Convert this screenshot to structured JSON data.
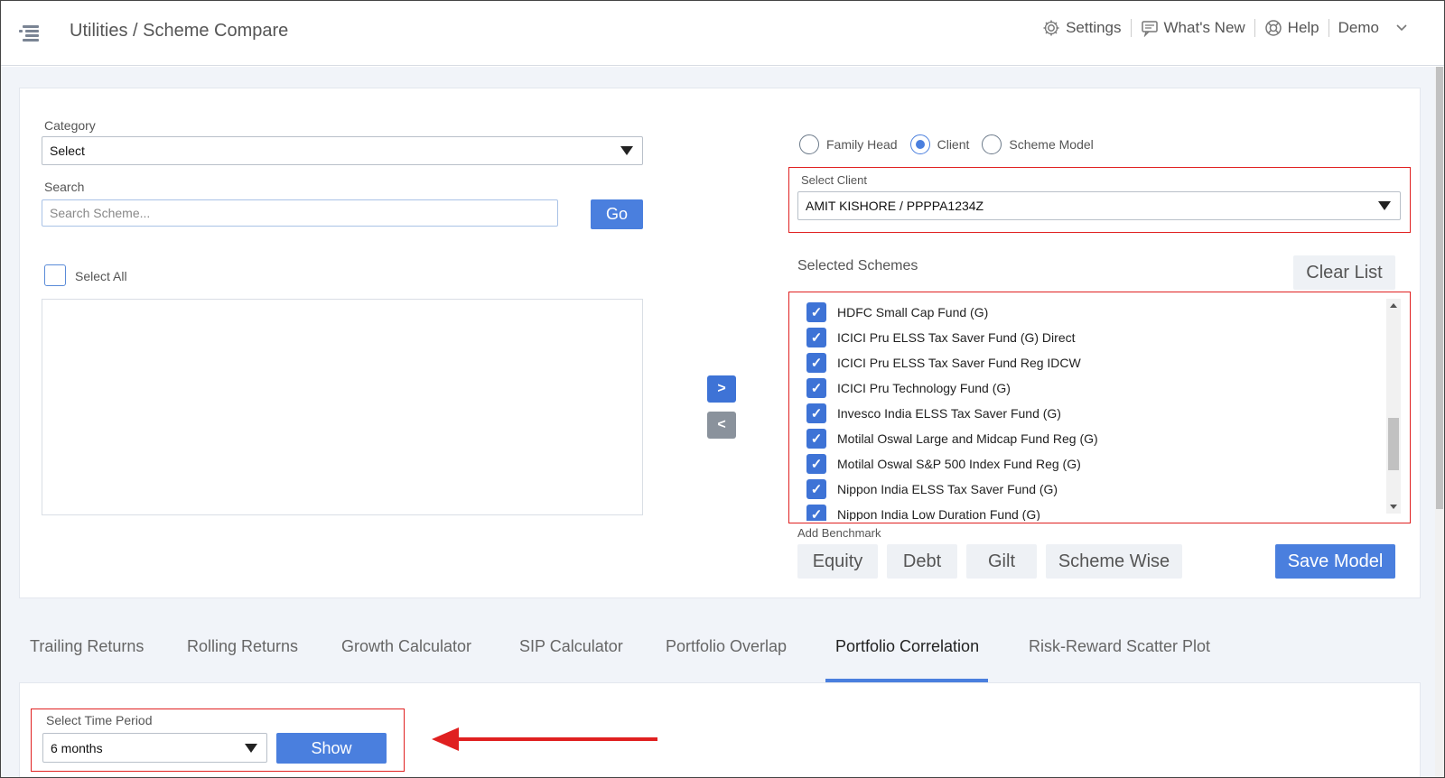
{
  "header": {
    "breadcrumb": "Utilities / Scheme Compare",
    "settings_label": "Settings",
    "whats_new_label": "What's New",
    "help_label": "Help",
    "user_label": "Demo"
  },
  "left_panel": {
    "category_label": "Category",
    "category_value": "Select",
    "search_label": "Search",
    "search_placeholder": "Search Scheme...",
    "go_label": "Go",
    "select_all_label": "Select All"
  },
  "transfer": {
    "add_label": ">",
    "remove_label": "<"
  },
  "right_panel": {
    "radio_options": [
      {
        "label": "Family Head",
        "selected": false
      },
      {
        "label": "Client",
        "selected": true
      },
      {
        "label": "Scheme Model",
        "selected": false
      }
    ],
    "select_client_label": "Select Client",
    "select_client_value": "AMIT KISHORE / PPPPA1234Z",
    "selected_schemes_label": "Selected Schemes",
    "clear_list_label": "Clear List",
    "schemes": [
      "HDFC Small Cap Fund (G)",
      "ICICI Pru ELSS Tax Saver Fund (G) Direct",
      "ICICI Pru ELSS Tax Saver Fund Reg IDCW",
      "ICICI Pru Technology Fund (G)",
      "Invesco India ELSS Tax Saver Fund (G)",
      "Motilal Oswal Large and Midcap Fund Reg (G)",
      "Motilal Oswal S&P 500 Index Fund Reg (G)",
      "Nippon India ELSS Tax Saver Fund (G)",
      "Nippon India Low Duration Fund (G)"
    ],
    "add_benchmark_label": "Add Benchmark",
    "benchmark_buttons": [
      "Equity",
      "Debt",
      "Gilt",
      "Scheme Wise"
    ],
    "save_model_label": "Save Model"
  },
  "tabs": [
    {
      "label": "Trailing Returns",
      "active": false
    },
    {
      "label": "Rolling Returns",
      "active": false
    },
    {
      "label": "Growth Calculator",
      "active": false
    },
    {
      "label": "SIP Calculator",
      "active": false
    },
    {
      "label": "Portfolio Overlap",
      "active": false
    },
    {
      "label": "Portfolio Correlation",
      "active": true
    },
    {
      "label": "Risk-Reward Scatter Plot",
      "active": false
    }
  ],
  "time_period": {
    "label": "Select Time Period",
    "value": "6 months",
    "show_label": "Show"
  },
  "colors": {
    "accent": "#4a7fde",
    "highlight": "#e02020"
  }
}
